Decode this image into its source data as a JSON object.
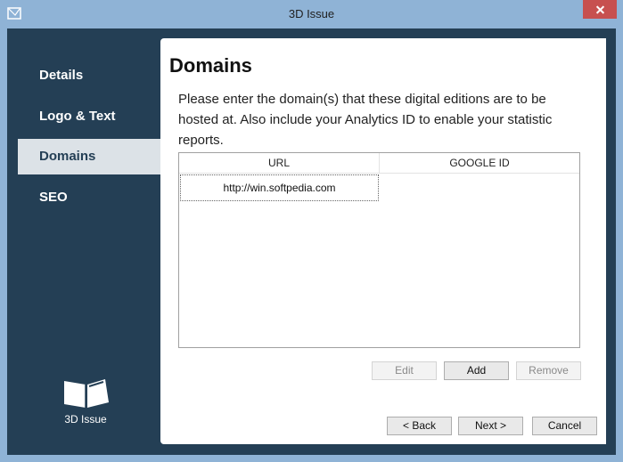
{
  "window": {
    "title": "3D Issue"
  },
  "sidebar": {
    "items": [
      {
        "label": "Details"
      },
      {
        "label": "Logo & Text"
      },
      {
        "label": "Domains",
        "active": true
      },
      {
        "label": "SEO"
      }
    ],
    "logo_text": "3D Issue"
  },
  "main": {
    "heading": "Domains",
    "description": "Please enter the domain(s) that these digital editions are to be hosted at. Also include your Analytics ID to enable your statistic reports.",
    "table": {
      "columns": [
        "URL",
        "GOOGLE ID"
      ],
      "rows": [
        {
          "url": "http://win.softpedia.com",
          "google_id": ""
        }
      ]
    },
    "row_buttons": {
      "edit": "Edit",
      "add": "Add",
      "remove": "Remove"
    },
    "footer_buttons": {
      "back": "< Back",
      "next": "Next >",
      "cancel": "Cancel"
    }
  },
  "colors": {
    "titlebar": "#8fb3d6",
    "sidebar": "#243f55",
    "active_item": "#dce2e7",
    "close": "#c7504f"
  }
}
